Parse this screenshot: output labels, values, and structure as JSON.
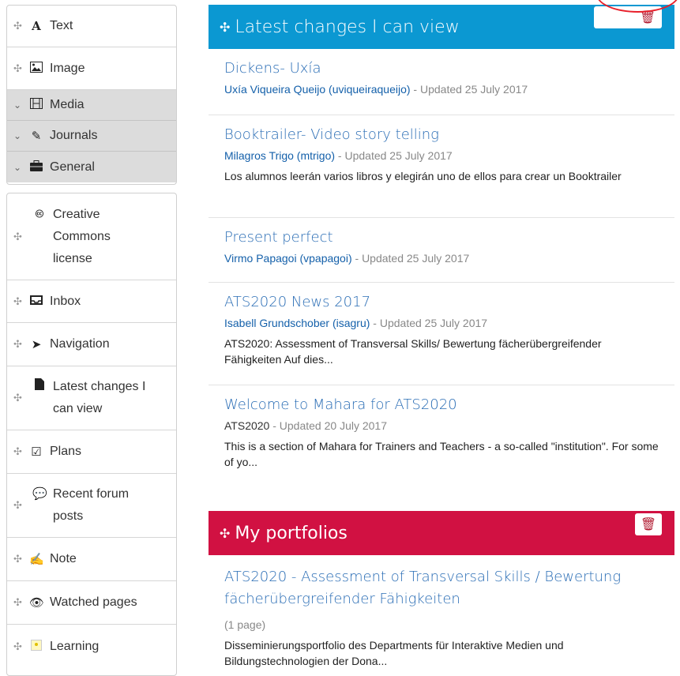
{
  "sidebar": {
    "group1": [
      {
        "label": "Text",
        "icon": "text-icon"
      },
      {
        "label": "Image",
        "icon": "image-icon"
      }
    ],
    "categories": [
      {
        "label": "Media",
        "icon": "film-icon"
      },
      {
        "label": "Journals",
        "icon": "pencil-icon"
      },
      {
        "label": "General",
        "icon": "briefcase-icon"
      }
    ],
    "group2": [
      {
        "label": "Creative Commons license",
        "icon": "creative-commons-icon"
      },
      {
        "label": "Inbox",
        "icon": "inbox-icon"
      },
      {
        "label": "Navigation",
        "icon": "location-arrow-icon"
      },
      {
        "label": "Latest changes I can view",
        "icon": "file-icon"
      },
      {
        "label": "Plans",
        "icon": "checkbox-icon"
      },
      {
        "label": "Recent forum posts",
        "icon": "comments-icon"
      },
      {
        "label": "Note",
        "icon": "edit-icon"
      },
      {
        "label": "Watched pages",
        "icon": "eye-icon"
      },
      {
        "label": "Learning",
        "icon": "learning-icon"
      }
    ]
  },
  "latest": {
    "title": "Latest changes I can view",
    "entries": [
      {
        "title": "Dickens- Uxía",
        "author": "Uxía Viqueira Queijo (uviqueiraqueijo)",
        "date": " - Updated 25 July 2017",
        "desc": ""
      },
      {
        "title": "Booktrailer- Video story telling",
        "author": "Milagros Trigo (mtrigo)",
        "date": " - Updated 25 July 2017",
        "desc": "Los alumnos leerán varios libros y elegirán uno de ellos para crear un Booktrailer"
      },
      {
        "title": "Present perfect",
        "author": "Virmo Papagoi (vpapagoi)",
        "date": " - Updated 25 July 2017",
        "desc": ""
      },
      {
        "title": "ATS2020 News 2017",
        "author": "Isabell Grundschober (isagru)",
        "date": " - Updated 25 July 2017",
        "desc": "ATS2020: Assessment of Transversal Skills/ Bewertung fächerübergreifender Fähigkeiten Auf dies..."
      },
      {
        "title": "Welcome to Mahara for ATS2020",
        "author": "ATS2020",
        "date": " - Updated 20 July 2017",
        "desc": "This is a section of Mahara for Trainers and Teachers - a so-called \"institution\". For some of yo..."
      }
    ]
  },
  "portfolios": {
    "title": "My portfolios",
    "entry": {
      "title": "ATS2020 - Assessment of Transversal Skills / Bewertung fächerübergreifender Fähigkeiten",
      "pages": "(1 page)",
      "desc": "Disseminierungsportfolio des Departments für Interaktive Medien und Bildungstechnologien der Dona..."
    }
  },
  "colors": {
    "blue_header": "#0b98d2",
    "red_header": "#d11142",
    "link": "#2a6db5",
    "annotation_circle": "#e8202b"
  }
}
